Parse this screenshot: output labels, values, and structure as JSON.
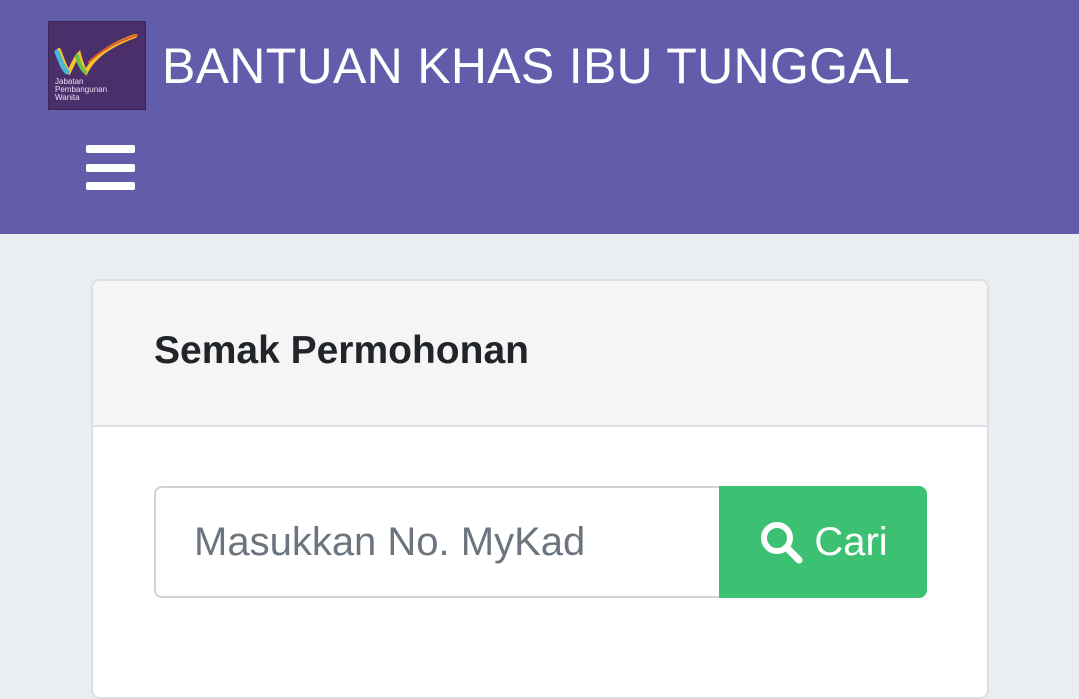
{
  "header": {
    "title": "BANTUAN KHAS IBU TUNGGAL",
    "logo": {
      "lines": [
        "Jabatan",
        "Pembangunan",
        "Wanita"
      ]
    },
    "menu_icon": "hamburger-icon",
    "background_color": "#625caa"
  },
  "card": {
    "title": "Semak Permohonan",
    "search": {
      "placeholder": "Masukkan No. MyKad",
      "value": "",
      "button_label": "Cari",
      "button_icon": "search-icon",
      "button_color": "#3cc173"
    }
  }
}
